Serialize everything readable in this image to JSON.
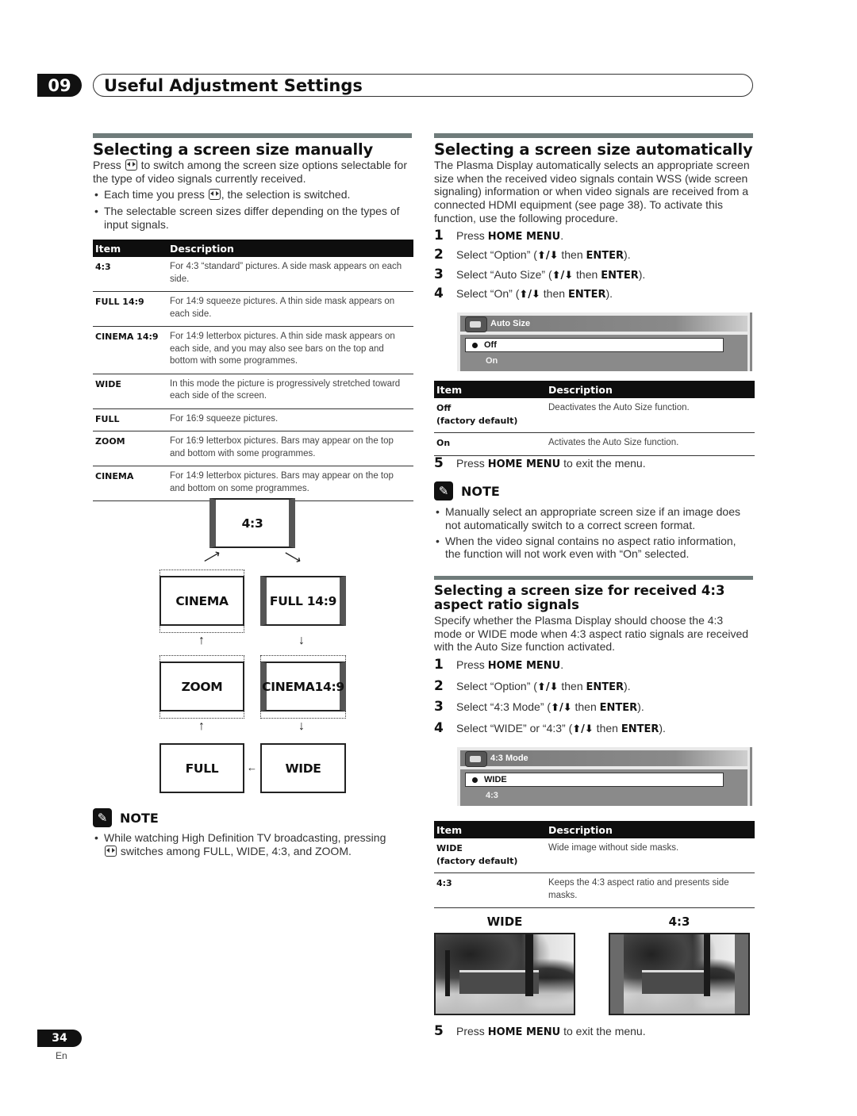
{
  "chapter": {
    "number": "09",
    "title": "Useful Adjustment Settings"
  },
  "manual": {
    "title": "Selecting a screen size manually",
    "intro_pre": "Press",
    "intro_post": "to switch among the screen size options selectable for the type of video signals currently received.",
    "button_icon": "screen-size-button-icon",
    "bullets": [
      {
        "pre": "Each time you press",
        "post": ", the selection is switched."
      },
      {
        "text": "The selectable screen sizes differ depending on the types of input signals."
      }
    ],
    "table": {
      "headers": [
        "Item",
        "Description"
      ],
      "rows": [
        {
          "item": "4:3",
          "desc": "For 4:3 “standard” pictures. A side mask appears on each side."
        },
        {
          "item": "FULL 14:9",
          "desc": "For 14:9 squeeze pictures. A thin side mask appears on each side."
        },
        {
          "item": "CINEMA 14:9",
          "desc": "For 14:9 letterbox pictures. A thin side mask appears on each side, and you may also see bars on the top and bottom with some programmes."
        },
        {
          "item": "WIDE",
          "desc": "In this mode the picture is progressively stretched toward each side of the screen."
        },
        {
          "item": "FULL",
          "desc": "For 16:9 squeeze pictures."
        },
        {
          "item": "ZOOM",
          "desc": "For 16:9 letterbox pictures. Bars may appear on the top and bottom with some programmes."
        },
        {
          "item": "CINEMA",
          "desc": "For 14:9 letterbox pictures. Bars may appear on the top and bottom on some programmes."
        }
      ]
    },
    "diagram": {
      "screens": {
        "s43": "4:3",
        "cinema": "CINEMA",
        "full149": "FULL 14:9",
        "zoom": "ZOOM",
        "cinema149": "CINEMA14:9",
        "full": "FULL",
        "wide": "WIDE"
      }
    },
    "note": {
      "label": "NOTE",
      "bullet_pre": "While watching High Definition TV broadcasting, pressing",
      "bullet_post": "switches among FULL, WIDE, 4:3, and ZOOM."
    }
  },
  "auto": {
    "title": "Selecting a screen size automatically",
    "intro": "The Plasma Display automatically selects an appropriate screen size when the received video signals contain WSS (wide screen signaling) information or when video signals are received from a connected HDMI equipment (see page 38). To activate this function, use the following procedure.",
    "steps": [
      {
        "num": "1",
        "pre": "Press ",
        "bold": "HOME MENU",
        "post": "."
      },
      {
        "num": "2",
        "pre": "Select “Option” (",
        "arrows": "⬆/⬇",
        "mid": " then ",
        "bold": "ENTER",
        "post": ")."
      },
      {
        "num": "3",
        "pre": "Select “Auto Size” (",
        "arrows": "⬆/⬇",
        "mid": " then ",
        "bold": "ENTER",
        "post": ")."
      },
      {
        "num": "4",
        "pre": "Select “On” (",
        "arrows": "⬆/⬇",
        "mid": " then ",
        "bold": "ENTER",
        "post": ")."
      }
    ],
    "osd": {
      "title": "Auto Size",
      "selected": "Off",
      "other": "On"
    },
    "table": {
      "headers": [
        "Item",
        "Description"
      ],
      "rows": [
        {
          "item": "Off",
          "item2": "(factory default)",
          "desc": "Deactivates the Auto Size function."
        },
        {
          "item": "On",
          "item2": "",
          "desc": "Activates the Auto Size function."
        }
      ]
    },
    "step5": {
      "num": "5",
      "pre": "Press ",
      "bold": "HOME MENU",
      "post": " to exit the menu."
    },
    "note": {
      "label": "NOTE",
      "bullets": [
        "Manually select an appropriate screen size if an image does not automatically switch to a correct screen format.",
        "When the video signal contains no aspect ratio information, the function will not work even with “On” selected."
      ]
    }
  },
  "mode43": {
    "title": "Selecting a screen size for received 4:3 aspect ratio signals",
    "intro": "Specify whether the Plasma Display should choose the 4:3 mode or WIDE mode when 4:3 aspect ratio signals are received with the Auto Size function activated.",
    "steps": [
      {
        "num": "1",
        "pre": "Press ",
        "bold": "HOME MENU",
        "post": "."
      },
      {
        "num": "2",
        "pre": "Select “Option” (",
        "arrows": "⬆/⬇",
        "mid": " then ",
        "bold": "ENTER",
        "post": ")."
      },
      {
        "num": "3",
        "pre": "Select “4:3 Mode” (",
        "arrows": "⬆/⬇",
        "mid": " then ",
        "bold": "ENTER",
        "post": ")."
      },
      {
        "num": "4",
        "pre": "Select “WIDE” or “4:3” (",
        "arrows": "⬆/⬇",
        "mid": " then ",
        "bold": "ENTER",
        "post": ")."
      }
    ],
    "osd": {
      "title": "4:3 Mode",
      "selected": "WIDE",
      "other": "4:3"
    },
    "table": {
      "headers": [
        "Item",
        "Description"
      ],
      "rows": [
        {
          "item": "WIDE",
          "item2": "(factory default)",
          "desc": "Wide image without side masks."
        },
        {
          "item": "4:3",
          "item2": "",
          "desc": "Keeps the 4:3 aspect ratio and presents side masks."
        }
      ]
    },
    "images": {
      "wide_label": "WIDE",
      "s43_label": "4:3"
    },
    "step5": {
      "num": "5",
      "pre": "Press ",
      "bold": "HOME MENU",
      "post": " to exit the menu."
    }
  },
  "footer": {
    "page": "34",
    "lang": "En"
  }
}
